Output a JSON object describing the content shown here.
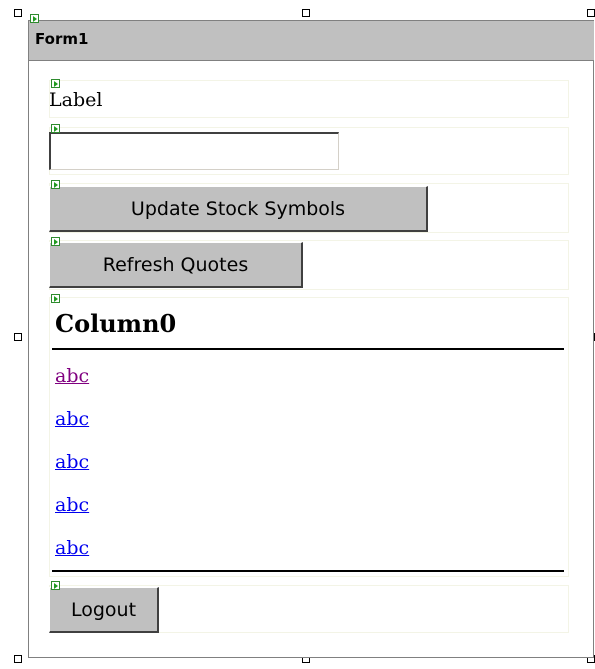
{
  "form": {
    "title": "Form1"
  },
  "controls": {
    "label": "Label",
    "textbox_value": "",
    "update_button": "Update Stock Symbols",
    "refresh_button": "Refresh Quotes",
    "logout_button": "Logout"
  },
  "grid": {
    "header": "Column0",
    "rows": [
      "abc",
      "abc",
      "abc",
      "abc",
      "abc"
    ]
  },
  "colors": {
    "titlebar": "#c0c0c0",
    "button_face": "#c0c0c0",
    "link": "#0000ee",
    "visited_link": "#800080",
    "control_icon": "#1f9a1f"
  },
  "icons": [
    "resize-handle-icon",
    "control-marker-icon"
  ]
}
